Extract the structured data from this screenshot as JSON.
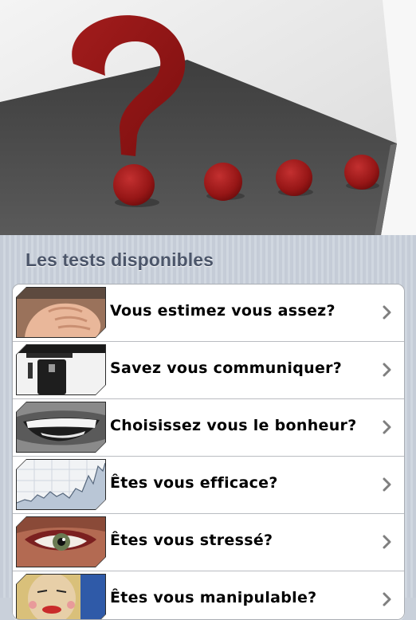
{
  "hero": {
    "image": "question-mark-ellipsis-illustration",
    "colors": {
      "accent_red": "#9e1a1a",
      "floor": "#4a4a4a",
      "wall": "#f2f2f2"
    }
  },
  "section": {
    "title": "Les tests disponibles"
  },
  "tests": [
    {
      "label": "Vous estimez vous assez?",
      "thumb": "fist-thumbnail"
    },
    {
      "label": "Savez vous communiquer?",
      "thumb": "microphone-thumbnail"
    },
    {
      "label": "Choisissez vous le bonheur?",
      "thumb": "smile-thumbnail"
    },
    {
      "label": "Êtes vous efficace?",
      "thumb": "stock-chart-thumbnail"
    },
    {
      "label": "Êtes vous stressé?",
      "thumb": "eye-glasses-thumbnail"
    },
    {
      "label": "Êtes vous manipulable?",
      "thumb": "puppet-face-thumbnail"
    }
  ],
  "icons": {
    "disclosure": "chevron-right-icon"
  }
}
